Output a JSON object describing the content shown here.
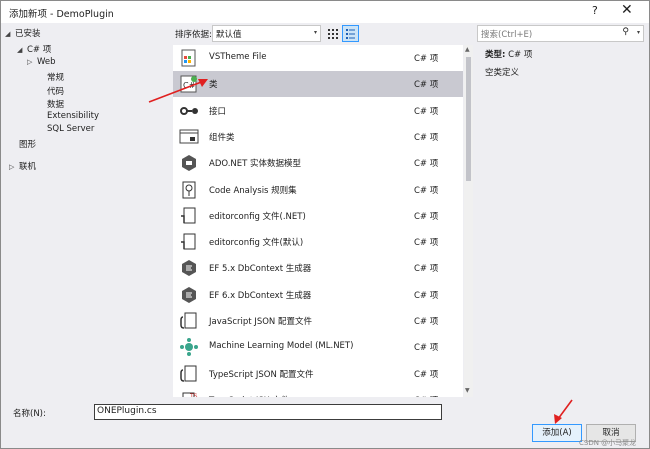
{
  "window": {
    "title": "添加新项 - DemoPlugin",
    "help_label": "?",
    "close_label": "✕"
  },
  "tree": [
    {
      "label": "已安装",
      "arrow": "◢"
    },
    {
      "label": "C# 项",
      "arrow": "◢"
    },
    {
      "label": "Web",
      "arrow": "▷"
    },
    {
      "label": "常规",
      "arrow": ""
    },
    {
      "label": "代码",
      "arrow": ""
    },
    {
      "label": "数据",
      "arrow": ""
    },
    {
      "label": "Extensibility",
      "arrow": ""
    },
    {
      "label": "SQL Server",
      "arrow": ""
    },
    {
      "label": "图形",
      "arrow": ""
    },
    {
      "label": "联机",
      "arrow": "▷"
    }
  ],
  "toolbar": {
    "sort_label": "排序依据:",
    "sort_value": "默认值",
    "dropdown_glyph": "▾"
  },
  "search": {
    "placeholder": "搜索(Ctrl+E)",
    "icon": "⚲"
  },
  "templates": [
    {
      "name": "VSTheme File",
      "lang": "C# 项",
      "icon": "theme"
    },
    {
      "name": "类",
      "lang": "C# 项",
      "icon": "class",
      "selected": true
    },
    {
      "name": "接口",
      "lang": "C# 项",
      "icon": "interface"
    },
    {
      "name": "组件类",
      "lang": "C# 项",
      "icon": "component"
    },
    {
      "name": "ADO.NET 实体数据模型",
      "lang": "C# 项",
      "icon": "ado"
    },
    {
      "name": "Code Analysis 规则集",
      "lang": "C# 项",
      "icon": "ruleset"
    },
    {
      "name": "editorconfig 文件(.NET)",
      "lang": "C# 项",
      "icon": "editorconfig"
    },
    {
      "name": "editorconfig 文件(默认)",
      "lang": "C# 项",
      "icon": "editorconfig"
    },
    {
      "name": "EF 5.x DbContext 生成器",
      "lang": "C# 项",
      "icon": "ef"
    },
    {
      "name": "EF 6.x DbContext 生成器",
      "lang": "C# 项",
      "icon": "ef"
    },
    {
      "name": "JavaScript JSON 配置文件",
      "lang": "C# 项",
      "icon": "json"
    },
    {
      "name": "Machine Learning Model (ML.NET)",
      "lang": "C# 项",
      "icon": "ml"
    },
    {
      "name": "TypeScript JSON 配置文件",
      "lang": "C# 项",
      "icon": "json"
    },
    {
      "name": "TypeScript JSX 文件",
      "lang": "C# 项",
      "icon": "ts"
    }
  ],
  "details": {
    "type_label": "类型:",
    "type_value": "C# 项",
    "description": "空类定义"
  },
  "name_field": {
    "label": "名称(N):",
    "value": "ONEPlugin.cs"
  },
  "buttons": {
    "add": "添加(A)",
    "cancel": "取消"
  },
  "watermark": "CSDN @小马聚龙",
  "colors": {
    "selection": "#c9c9d1",
    "accent": "#3399ff",
    "annotation_arrow": "#e02020"
  }
}
